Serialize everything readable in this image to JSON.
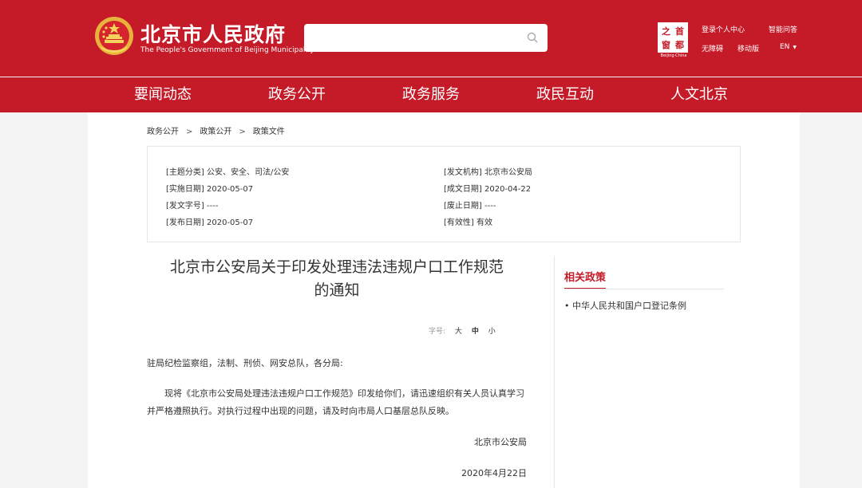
{
  "header": {
    "title": "北京市人民政府",
    "subtitle": "The People's Government of Beijing Municipality",
    "logo_chars": [
      "之",
      "首",
      "窗",
      "都"
    ],
    "logo_caption": "Beijing·China",
    "login": "登录个人中心",
    "qa": "智能问答",
    "barrier_free": "无障碍",
    "mobile": "移动版",
    "lang": "EN",
    "brand_color": "#c51b29"
  },
  "nav": [
    "要闻动态",
    "政务公开",
    "政务服务",
    "政民互动",
    "人文北京"
  ],
  "breadcrumb": [
    "政务公开",
    "政策公开",
    "政策文件"
  ],
  "breadcrumb_sep": ">",
  "meta": {
    "topic": {
      "k": "[主题分类]",
      "v": "公安、安全、司法/公安"
    },
    "issuer": {
      "k": "[发文机构]",
      "v": "北京市公安局"
    },
    "impl_date": {
      "k": "[实施日期]",
      "v": "2020-05-07"
    },
    "form_date": {
      "k": "[成文日期]",
      "v": "2020-04-22"
    },
    "doc_no": {
      "k": "[发文字号]",
      "v": "----"
    },
    "expire_date": {
      "k": "[废止日期]",
      "v": "----"
    },
    "pub_date": {
      "k": "[发布日期]",
      "v": "2020-05-07"
    },
    "validity": {
      "k": "[有效性]",
      "v": "有效"
    }
  },
  "article": {
    "title_line1": "北京市公安局关于印发处理违法违规户口工作规范",
    "title_line2": "的通知",
    "fontsize_label": "字号:",
    "fontsize_large": "大",
    "fontsize_medium": "中",
    "fontsize_small": "小",
    "salutation": "驻局纪检监察组，法制、刑侦、网安总队，各分局:",
    "body": "现将《北京市公安局处理违法违规户口工作规范》印发给你们，请迅速组织有关人员认真学习并严格遵照执行。对执行过程中出现的问题，请及时向市局人口基层总队反映。",
    "signature": "北京市公安局",
    "date": "2020年4月22日"
  },
  "sidebar": {
    "title": "相关政策",
    "items": [
      "• 中华人民共和国户口登记条例"
    ]
  }
}
